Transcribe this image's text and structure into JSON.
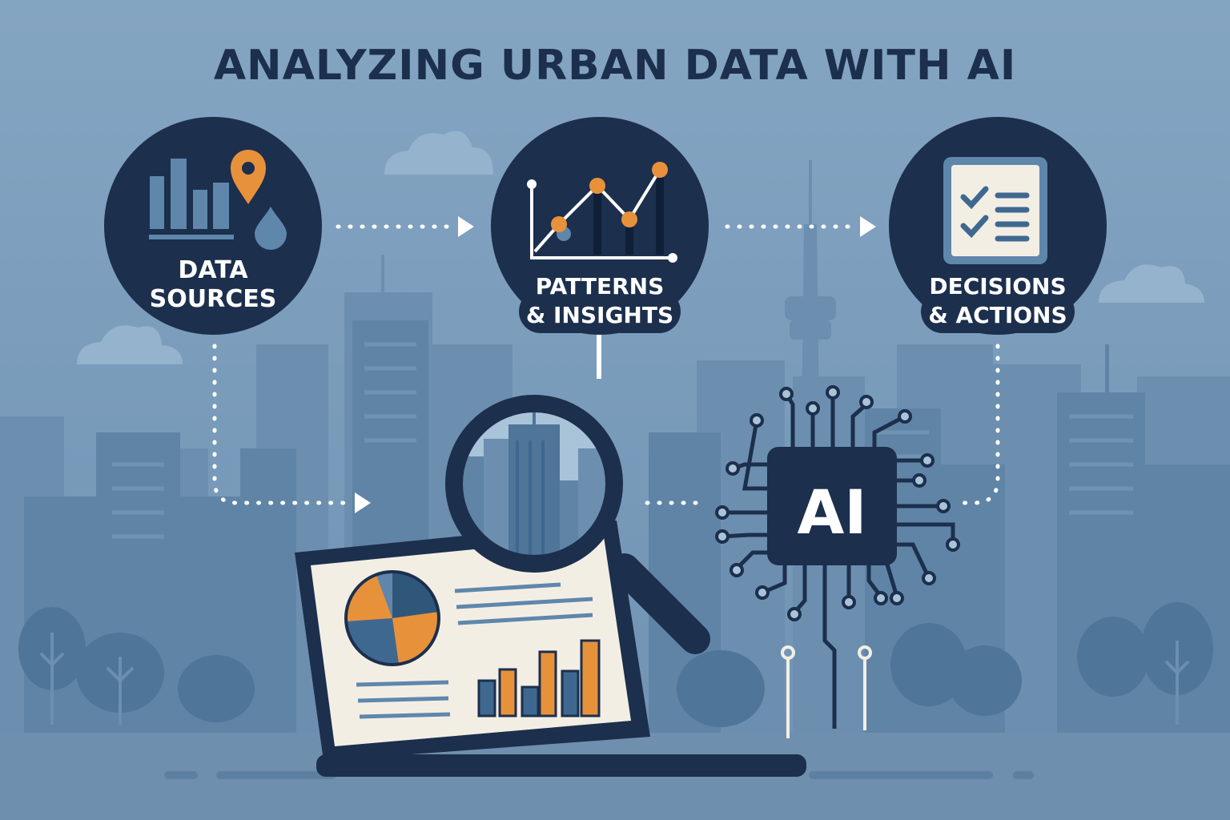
{
  "title": "ANALYZING URBAN DATA WITH AI",
  "steps": [
    {
      "line1": "DATA",
      "line2": "SOURCES",
      "icon": "bar-chart-location-pin-water-drop-icon"
    },
    {
      "line1": "PATTERNS",
      "line2": "& INSIGHTS",
      "icon": "line-chart-icon"
    },
    {
      "line1": "DECISIONS",
      "line2": "& ACTIONS",
      "icon": "checklist-icon"
    }
  ],
  "chip": {
    "label": "AI",
    "icon": "circuit-chip-icon"
  },
  "colors": {
    "background": "#7fa0bd",
    "navy": "#1c2f4d",
    "orange": "#e8913b",
    "skyline": "#5f84a6",
    "screen": "#f3eee4"
  }
}
